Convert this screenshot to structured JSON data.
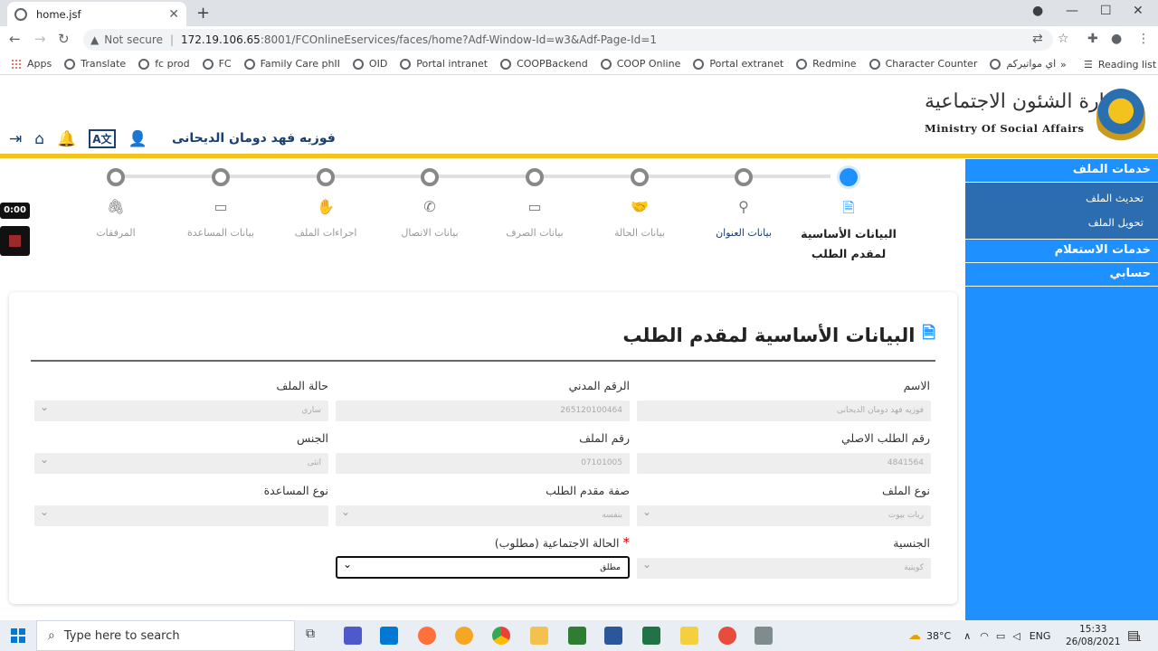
{
  "browser": {
    "tab_title": "home.jsf",
    "url_warning": "Not secure",
    "url_host": "172.19.106.65",
    "url_path": ":8001/FCOnlineEservices/faces/home?Adf-Window-Id=w3&Adf-Page-Id=1",
    "bookmarks": [
      "Apps",
      "Translate",
      "fc prod",
      "FC",
      "Family Care phII",
      "OID",
      "Portal intranet",
      "COOPBackend",
      "COOP Online",
      "Portal extranet",
      "Redmine",
      "Character Counter",
      "اي مواتيركم"
    ],
    "reading_list": "Reading list"
  },
  "header": {
    "user_name": "فوزيه فهد دومان الديحانى",
    "logo_ar": "وزارة الشئون الاجتماعية",
    "logo_en": "Ministry Of Social Affairs"
  },
  "sidebar": {
    "sections": [
      {
        "title": "خدمات الملف",
        "items": [
          "تحديث الملف",
          "تحويل الملف"
        ]
      },
      {
        "title": "خدمات الاستعلام",
        "items": []
      },
      {
        "title": "حسابي",
        "items": []
      }
    ]
  },
  "recorder": {
    "time": "0:00"
  },
  "stepper": {
    "steps": [
      {
        "label": "البيانات الأساسية لمقدم الطلب",
        "icon": "file-icon",
        "state": "active"
      },
      {
        "label": "بيانات العنوان",
        "icon": "map-pin-icon",
        "state": "current"
      },
      {
        "label": "بيانات الحالة",
        "icon": "handshake-icon",
        "state": "pending"
      },
      {
        "label": "بيانات الصرف",
        "icon": "money-icon",
        "state": "pending"
      },
      {
        "label": "بيانات الاتصال",
        "icon": "phone-icon",
        "state": "pending"
      },
      {
        "label": "اجراءات الملف",
        "icon": "hand-icon",
        "state": "pending"
      },
      {
        "label": "بيانات المساعدة",
        "icon": "money-icon",
        "state": "pending"
      },
      {
        "label": "المرفقات",
        "icon": "paperclip-icon",
        "state": "pending"
      }
    ]
  },
  "form": {
    "title": "البيانات الأساسية لمقدم الطلب",
    "fields": {
      "name": {
        "label": "الاسم",
        "value": "فوزيه فهد دومان الديحانى"
      },
      "civil_id": {
        "label": "الرقم المدني",
        "value": "265120100464"
      },
      "file_status": {
        "label": "حالة الملف",
        "value": "ساري"
      },
      "orig_request": {
        "label": "رقم الطلب الاصلي",
        "value": "4841564"
      },
      "file_number": {
        "label": "رقم الملف",
        "value": "07101005"
      },
      "gender": {
        "label": "الجنس",
        "value": "انثى"
      },
      "file_type": {
        "label": "نوع الملف",
        "value": "ربات بيوت"
      },
      "applicant_role": {
        "label": "صفة مقدم الطلب",
        "value": "بنفسه"
      },
      "aid_type": {
        "label": "نوع المساعدة",
        "value": ""
      },
      "nationality": {
        "label": "الجنسية",
        "value": "كويتية"
      },
      "social_status": {
        "label": "الحالة الاجتماعية (مطلوب)",
        "required_mark": "*",
        "value": "مطلق"
      }
    }
  },
  "taskbar": {
    "search_placeholder": "Type here to search",
    "temperature": "38°C",
    "language": "ENG",
    "time": "15:33",
    "date": "26/08/2021",
    "notifications": "1"
  }
}
